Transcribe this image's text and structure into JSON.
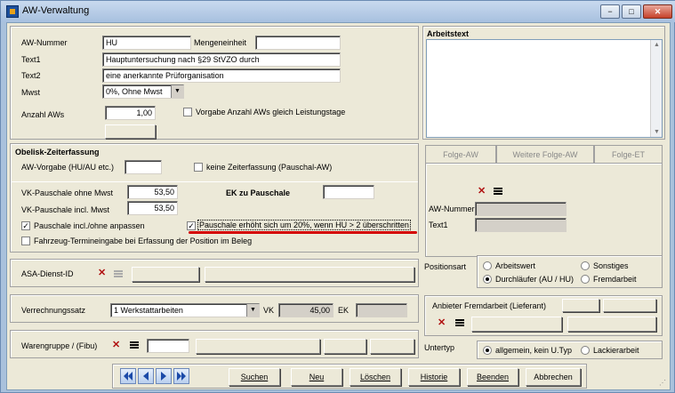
{
  "window": {
    "title": "AW-Verwaltung",
    "min_label": "−",
    "max_label": "□",
    "close_label": "✕"
  },
  "stamm": {
    "aw_nummer_label": "AW-Nummer",
    "aw_nummer_value": "HU",
    "mengeneinheit_label": "Mengeneinheit",
    "mengeneinheit_value": "",
    "text1_label": "Text1",
    "text1_value": "Hauptuntersuchung nach §29 StVZO durch",
    "text2_label": "Text2",
    "text2_value": "eine anerkannte Prüforganisation",
    "mwst_label": "Mwst",
    "mwst_value": "0%, Ohne Mwst",
    "anzahl_label": "Anzahl AWs",
    "anzahl_value": "1,00",
    "vorgabe_anzahl_label": "Vorgabe Anzahl AWs gleich Leistungstage",
    "vorgabe_anzahl_checked": false
  },
  "arbeitstext": {
    "label": "Arbeitstext",
    "value": ""
  },
  "obelisk": {
    "title": "Obelisk-Zeiterfassung",
    "aw_vorgabe_label": "AW-Vorgabe (HU/AU etc.)",
    "aw_vorgabe_value": "",
    "keine_zeit_label": "keine Zeiterfassung (Pauschal-AW)",
    "keine_zeit_checked": false
  },
  "pauschale": {
    "vk_ohne_label": "VK-Pauschale ohne Mwst",
    "vk_ohne_value": "53,50",
    "vk_incl_label": "VK-Pauschale incl. Mwst",
    "vk_incl_value": "53,50",
    "ek_label": "EK zu Pauschale",
    "ek_value": "",
    "anpassen_label": "Pauschale incl./ohne anpassen",
    "anpassen_checked": true,
    "erhoeht_label": "Pauschale erhöht sich um 20%, wenn HU > 2 überschritten",
    "erhoeht_checked": true,
    "termin_label": "Fahrzeug-Termineingabe bei Erfassung der Position im Beleg",
    "termin_checked": false,
    "highlight_color": "#d40000"
  },
  "folge_tabs": {
    "tab1": "Folge-AW",
    "tab2": "Weitere Folge-AW",
    "tab3": "Folge-ET"
  },
  "folge": {
    "aw_nummer_label": "AW-Nummer",
    "text1_label": "Text1"
  },
  "asa": {
    "label": "ASA-Dienst-ID"
  },
  "verrechnung": {
    "label": "Verrechnungssatz",
    "value": "1 Werkstattarbeiten",
    "vk_label": "VK",
    "vk_value": "45,00",
    "ek_label": "EK",
    "ek_value": ""
  },
  "warengruppe": {
    "label": "Warengruppe / (Fibu)"
  },
  "positionsart": {
    "label": "Positionsart",
    "options": [
      "Arbeitswert",
      "Sonstiges",
      "Durchläufer (AU / HU)",
      "Fremdarbeit"
    ],
    "selected": "Durchläufer (AU / HU)"
  },
  "anbieter": {
    "label": "Anbieter Fremdarbeit (Lieferant)"
  },
  "untertyp": {
    "label": "Untertyp",
    "options": [
      "allgemein, kein U.Typ",
      "Lackierarbeit"
    ],
    "selected": "allgemein, kein U.Typ"
  },
  "footer": {
    "suchen": "Suchen",
    "neu": "Neu",
    "loeschen": "Löschen",
    "historie": "Historie",
    "beenden": "Beenden",
    "abbrechen": "Abbrechen"
  },
  "icons": [
    "app-icon",
    "delete-x-icon",
    "list-icon",
    "first-record-icon",
    "prev-record-icon",
    "next-record-icon",
    "last-record-icon"
  ]
}
